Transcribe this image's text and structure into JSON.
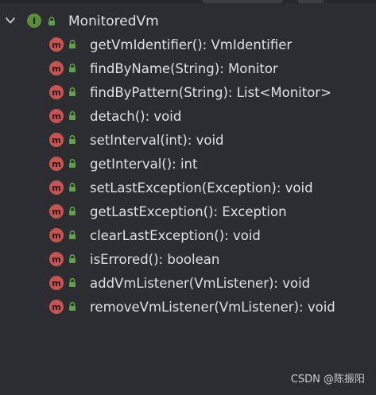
{
  "tree": {
    "root": {
      "label": "MonitoredVm",
      "expand_icon": "chevron-down-icon",
      "type_icon": "interface-icon",
      "type_icon_letter": "I",
      "visibility_icon": "lock-icon"
    },
    "method_icon_letter": "m",
    "methods": [
      {
        "label": "getVmIdentifier(): VmIdentifier"
      },
      {
        "label": "findByName(String): Monitor"
      },
      {
        "label": "findByPattern(String): List<Monitor>"
      },
      {
        "label": "detach(): void"
      },
      {
        "label": "setInterval(int): void"
      },
      {
        "label": "getInterval(): int"
      },
      {
        "label": "setLastException(Exception): void"
      },
      {
        "label": "getLastException(): Exception"
      },
      {
        "label": "clearLastException(): void"
      },
      {
        "label": "isErrored(): boolean"
      },
      {
        "label": "addVmListener(VmListener): void"
      },
      {
        "label": "removeVmListener(VmListener): void"
      }
    ]
  },
  "watermark": "CSDN @陈振阳",
  "colors": {
    "background": "#2b2d30",
    "text": "#dfe1e5",
    "interface_icon": "#5a8c3a",
    "method_icon": "#c75450",
    "lock_icon": "#5fa14a"
  }
}
